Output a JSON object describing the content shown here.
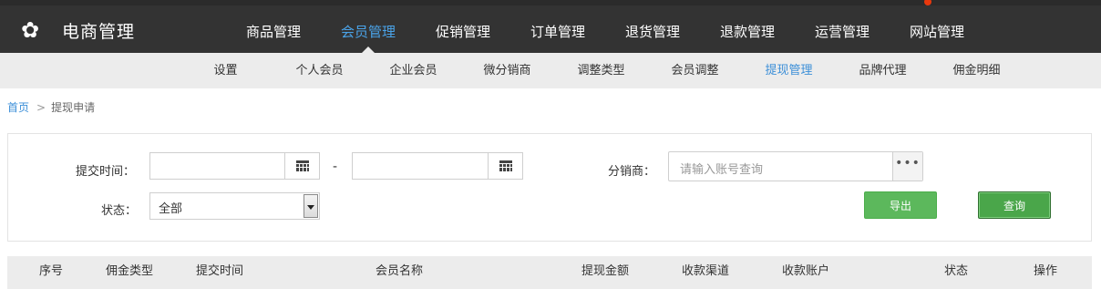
{
  "header": {
    "logo_text": "电商管理",
    "nav": [
      {
        "label": "商品管理",
        "active": false
      },
      {
        "label": "会员管理",
        "active": true
      },
      {
        "label": "促销管理",
        "active": false
      },
      {
        "label": "订单管理",
        "active": false
      },
      {
        "label": "退货管理",
        "active": false
      },
      {
        "label": "退款管理",
        "active": false
      },
      {
        "label": "运营管理",
        "active": false
      },
      {
        "label": "网站管理",
        "active": false
      }
    ]
  },
  "subnav": [
    {
      "label": "设置",
      "active": false
    },
    {
      "label": "个人会员",
      "active": false
    },
    {
      "label": "企业会员",
      "active": false
    },
    {
      "label": "微分销商",
      "active": false
    },
    {
      "label": "调整类型",
      "active": false
    },
    {
      "label": "会员调整",
      "active": false
    },
    {
      "label": "提现管理",
      "active": true
    },
    {
      "label": "品牌代理",
      "active": false
    },
    {
      "label": "佣金明细",
      "active": false
    }
  ],
  "breadcrumb": {
    "home": "首页",
    "separator": ">",
    "current": "提现申请"
  },
  "filters": {
    "submit_time_label": "提交时间：",
    "date_start_value": "",
    "date_end_value": "",
    "range_dash": "-",
    "distributor_label": "分销商：",
    "distributor_placeholder": "请输入账号查询",
    "more_glyph": "•••",
    "status_label": "状态：",
    "status_selected": "全部",
    "export_label": "导出",
    "query_label": "查询"
  },
  "table": {
    "columns": [
      "序号",
      "佣金类型",
      "提交时间",
      "会员名称",
      "提现金额",
      "收款渠道",
      "收款账户",
      "状态",
      "操作"
    ]
  },
  "colors": {
    "header_bg": "#333333",
    "accent_blue": "#4aa3e8",
    "button_green": "#5cb85c"
  }
}
